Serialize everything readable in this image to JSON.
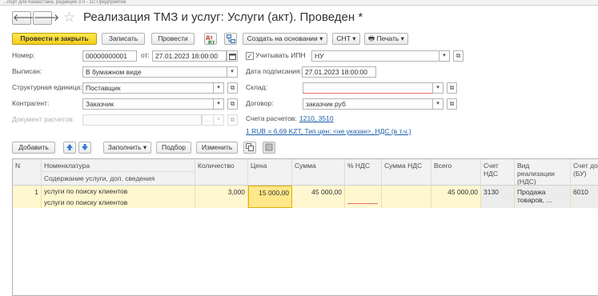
{
  "window": {
    "topbar_text": "...порт для Казахстана, редакция 3.0 - 1С:Предприятие",
    "title": "Реализация ТМЗ и услуг: Услуги (акт). Проведен *"
  },
  "toolbar": {
    "post_close": "Провести и закрыть",
    "save": "Записать",
    "post": "Провести",
    "create_based": "Создать на основании",
    "snt": "СНТ",
    "print": "Печать"
  },
  "form": {
    "number_label": "Номер:",
    "number_value": "00000000001",
    "date_label": "от:",
    "date_value": "27.01.2023 18:00:00",
    "ipn_label": "Учитывать ИПН",
    "ipn_value": "НУ",
    "issued_label": "Выписан:",
    "issued_value": "В бумажном виде",
    "sign_date_label": "Дата подписания:",
    "sign_date_value": "27.01.2023 18:00:00",
    "struct_label": "Структурная единица:",
    "struct_value": "Поставщик",
    "warehouse_label": "Склад:",
    "warehouse_value": "",
    "counterparty_label": "Контрагент:",
    "counterparty_value": "Заказчик",
    "contract_label": "Договор:",
    "contract_value": "заказчик руб",
    "settlement_doc_label": "Документ расчетов:",
    "settlement_doc_value": "",
    "accounts_label": "Счета расчетов:",
    "accounts_link": "1210, 3510",
    "rate_link": "1 RUB = 6,69 KZT, Тип цен: <не указан>, НДС (в т.ч.)"
  },
  "table_toolbar": {
    "add": "Добавить",
    "fill": "Заполнить",
    "select": "Подбор",
    "change": "Изменить"
  },
  "table": {
    "headers": {
      "n": "N",
      "nomenclature": "Номенклатура",
      "content": "Содержание услуги, доп. сведения",
      "qty": "Количество",
      "price": "Цена",
      "sum": "Сумма",
      "vat_pct": "% НДС",
      "vat_sum": "Сумма НДС",
      "total": "Всего",
      "vat_account_1": "Счет",
      "vat_account_2": "НДС",
      "sale_kind_1": "Вид реализации",
      "sale_kind_2": "(НДС)",
      "income_acc_1": "Счет дох",
      "income_acc_2": "(БУ)"
    },
    "rows": [
      {
        "n": "1",
        "nomenclature": "услуги по поиску клиентов",
        "content": "услуги по поиску клиентов",
        "qty": "3,000",
        "price": "15 000,00",
        "sum": "45 000,00",
        "vat_pct": "",
        "vat_sum": "",
        "total": "45 000,00",
        "vat_account": "3130",
        "sale_kind_1": "Продажа",
        "sale_kind_2": "товаров, ...",
        "income_acc": "6010"
      }
    ]
  },
  "icons": {
    "back": "arrow-left-icon",
    "forward": "arrow-right-icon",
    "favorite": "star-icon",
    "dt_kt": "dt-kt-icon",
    "structure": "structure-icon",
    "printer": "printer-icon",
    "calendar": "calendar-icon",
    "move_up": "arrow-up-icon",
    "move_down": "arrow-down-icon",
    "copy": "copy-icon",
    "paste": "paste-icon"
  },
  "colors": {
    "primary_button": "#f5cd1a",
    "selected_row": "#fff7cf",
    "active_cell_border": "#e0b000",
    "link": "#1c5ea8",
    "nav_arrow_blue": "#2f7bd3"
  }
}
